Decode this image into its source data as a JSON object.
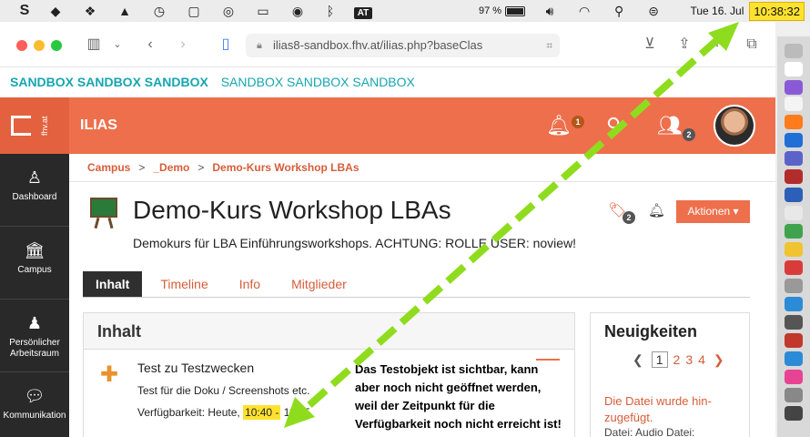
{
  "menubar": {
    "battery_pct": "97 %",
    "battery_level": 0.97,
    "at_label": "AT",
    "date": "Tue 16. Jul",
    "time": "10:38:32"
  },
  "browser": {
    "url": "ilias8-sandbox.fhv.at/ilias.php?baseClas"
  },
  "sandbox": {
    "primary": "SANDBOX SANDBOX SANDBOX",
    "secondary": "SANDBOX SANDBOX SANDBOX"
  },
  "header": {
    "logo_text": "fhv.at",
    "brand": "ILIAS",
    "notifications_count": "1",
    "contacts_count": "2"
  },
  "leftnav": {
    "items": [
      {
        "label": "Dashboard",
        "icon": "dashboard-icon"
      },
      {
        "label": "Campus",
        "icon": "campus-icon"
      },
      {
        "label": "Persönlicher Arbeitsraum",
        "icon": "person-icon"
      },
      {
        "label": "Kommunikation",
        "icon": "chat-icon"
      }
    ]
  },
  "breadcrumb": [
    "Campus",
    "_Demo",
    "Demo-Kurs Workshop LBAs"
  ],
  "course": {
    "title": "Demo-Kurs Workshop LBAs",
    "description": "Demokurs für LBA Einführungsworkshops. ACHTUNG: ROLLE USER: noview!",
    "tag_count": "2",
    "actions_label": "Aktionen ▾"
  },
  "tabs": [
    "Inhalt",
    "Timeline",
    "Info",
    "Mitglieder"
  ],
  "content": {
    "heading": "Inhalt",
    "item": {
      "title": "Test zu Testzwecken",
      "description": "Test für die Doku / Screenshots etc.",
      "availability_prefix": "Verfügbarkeit: Heute, ",
      "availability_start": "10:40 -",
      "availability_end": " 11:35"
    }
  },
  "callout": "Das Testobjekt ist sichtbar, kann aber noch nicht geöffnet werden, weil der Zeitpunkt für die Verfügbarkeit noch nicht erreicht ist!",
  "news": {
    "heading": "Neuigkeiten",
    "pages": [
      "1",
      "2",
      "3",
      "4"
    ],
    "current_page": "1",
    "text": "Die Datei wurde hin-zugefügt.",
    "sub": "Datei: Audio Datei:"
  },
  "colors": {
    "header": "#ee6f4c",
    "accent": "#d65d3a",
    "highlight": "#ffe22f",
    "arrow": "#8fdc1e",
    "sandbox_text": "#16a6b0"
  }
}
